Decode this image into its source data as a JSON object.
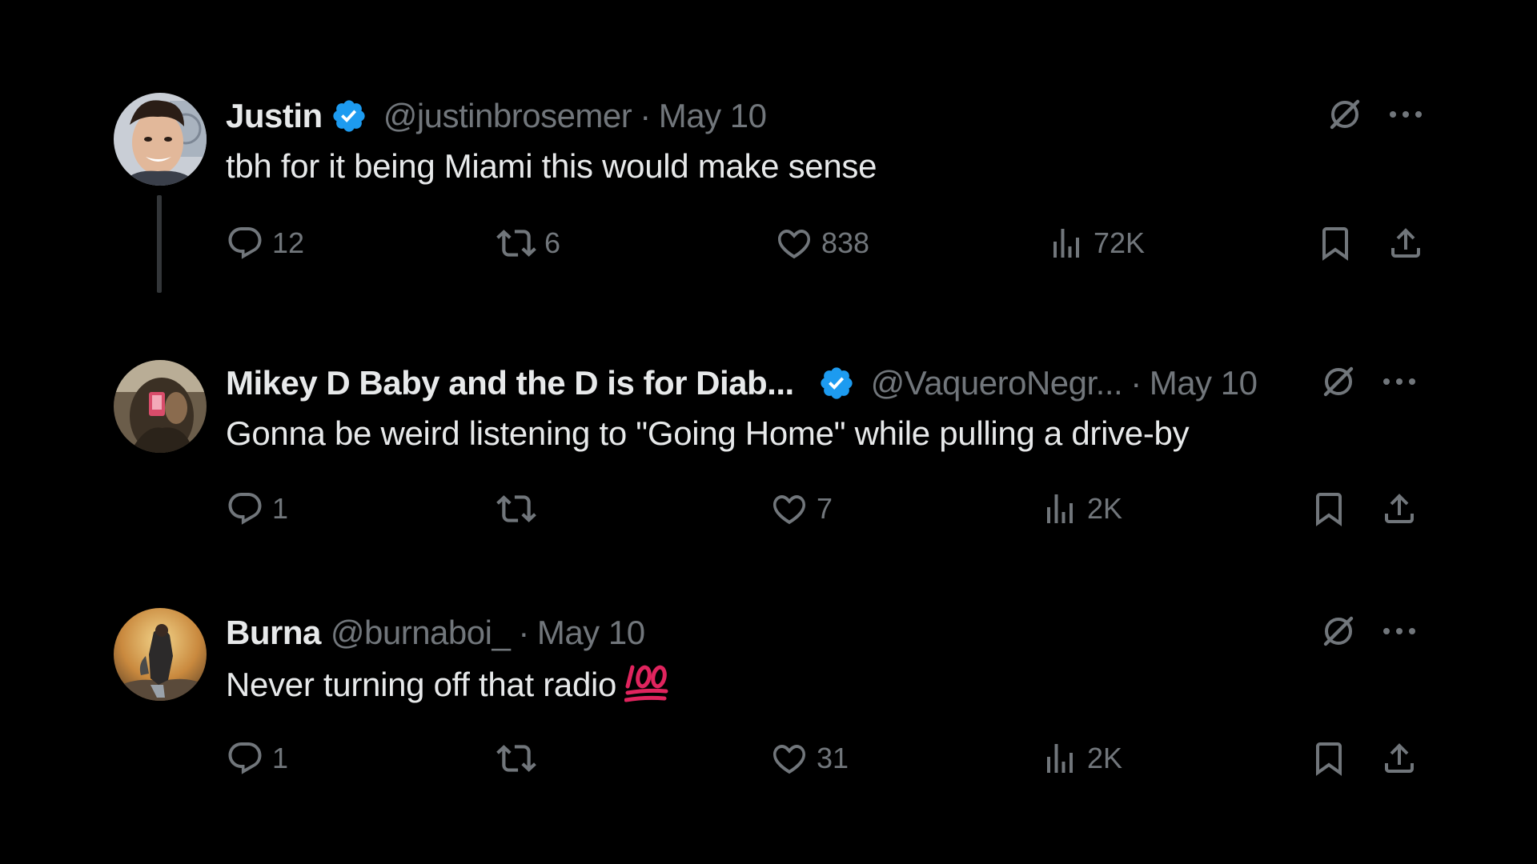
{
  "colors": {
    "background": "#000000",
    "primary_text": "#e7e9ea",
    "secondary_text": "#71767b",
    "verified_blue": "#1d9bf0",
    "emoji_red": "#e0245e"
  },
  "tweets": [
    {
      "name": "Justin",
      "verified": true,
      "handle": "@justinbrosemer",
      "separator": "·",
      "date": "May 10",
      "text": "tbh for it being Miami this would make sense",
      "replies": "12",
      "reposts": "6",
      "likes": "838",
      "views": "72K",
      "avatar_icon": "avatar-photo"
    },
    {
      "name": "Mikey D Baby and the D is for Diab...",
      "verified": true,
      "handle": "@VaqueroNegr...",
      "separator": "·",
      "date": "May 10",
      "text": "Gonna be weird listening to \"Going Home\" while pulling a drive-by",
      "replies": "1",
      "reposts": "",
      "likes": "7",
      "views": "2K",
      "avatar_icon": "avatar-photo"
    },
    {
      "name": "Burna",
      "verified": false,
      "handle": "@burnaboi_",
      "separator": "·",
      "date": "May 10",
      "text": "Never turning off that radio",
      "emoji": "hundred-points-icon",
      "replies": "1",
      "reposts": "",
      "likes": "31",
      "views": "2K",
      "avatar_icon": "avatar-photo"
    }
  ]
}
